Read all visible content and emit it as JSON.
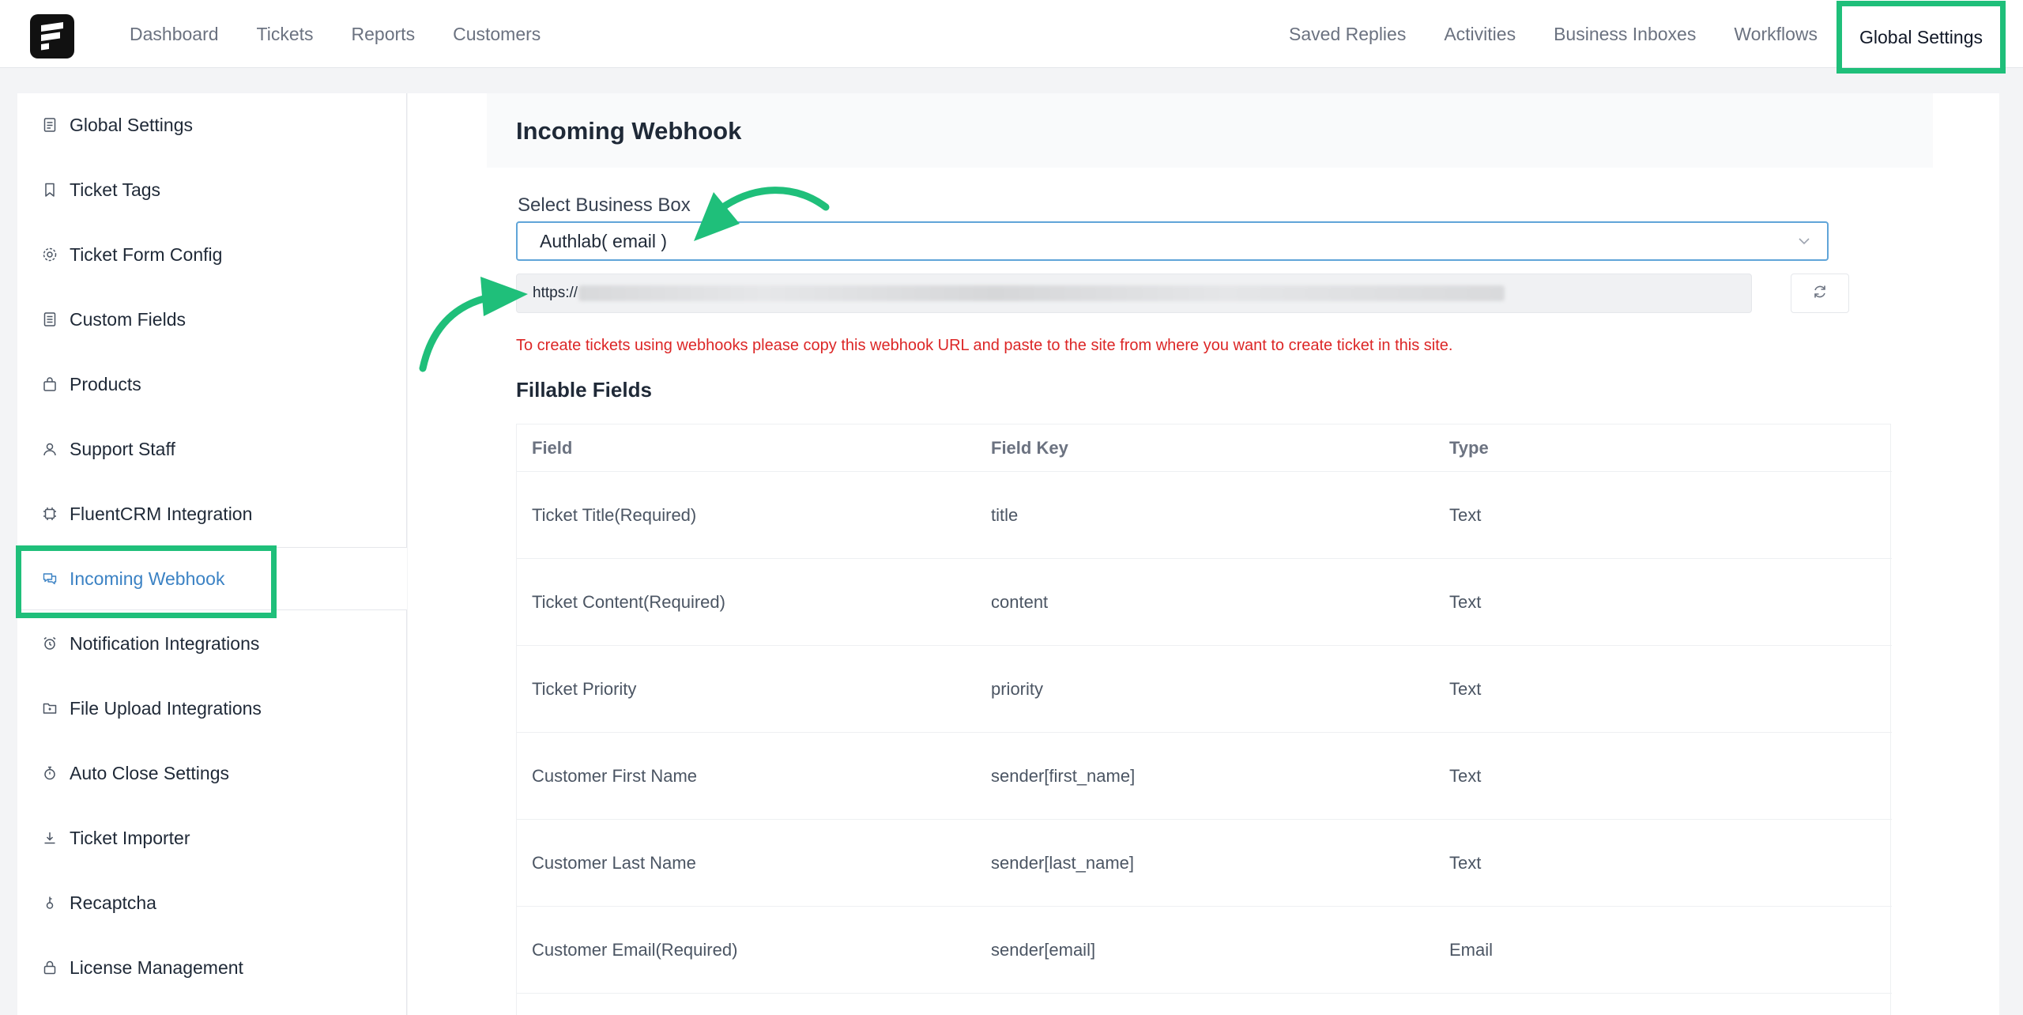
{
  "topnav": {
    "left": [
      "Dashboard",
      "Tickets",
      "Reports",
      "Customers"
    ],
    "right": [
      "Saved Replies",
      "Activities",
      "Business Inboxes",
      "Workflows"
    ],
    "active": "Global Settings"
  },
  "sidebar": {
    "items": [
      {
        "label": "Global Settings",
        "icon": "document-icon"
      },
      {
        "label": "Ticket Tags",
        "icon": "bookmark-icon"
      },
      {
        "label": "Ticket Form Config",
        "icon": "gear-icon"
      },
      {
        "label": "Custom Fields",
        "icon": "list-icon"
      },
      {
        "label": "Products",
        "icon": "bag-icon"
      },
      {
        "label": "Support Staff",
        "icon": "user-icon"
      },
      {
        "label": "FluentCRM Integration",
        "icon": "chip-icon"
      },
      {
        "label": "Incoming Webhook",
        "icon": "chat-icon"
      },
      {
        "label": "Notification Integrations",
        "icon": "alarm-icon"
      },
      {
        "label": "File Upload Integrations",
        "icon": "folder-icon"
      },
      {
        "label": "Auto Close Settings",
        "icon": "timer-icon"
      },
      {
        "label": "Ticket Importer",
        "icon": "download-icon"
      },
      {
        "label": "Recaptcha",
        "icon": "key-icon"
      },
      {
        "label": "License Management",
        "icon": "lock-icon"
      }
    ],
    "active_index": 7
  },
  "main": {
    "title": "Incoming Webhook",
    "select_label": "Select Business Box",
    "select_value": "Authlab( email )",
    "url_value": "https://",
    "notice": "To create tickets using webhooks please copy this webhook URL and paste to the site from where you want to create ticket in this site.",
    "fields_title": "Fillable Fields",
    "table": {
      "headers": [
        "Field",
        "Field Key",
        "Type"
      ],
      "rows": [
        [
          "Ticket Title(Required)",
          "title",
          "Text"
        ],
        [
          "Ticket Content(Required)",
          "content",
          "Text"
        ],
        [
          "Ticket Priority",
          "priority",
          "Text"
        ],
        [
          "Customer First Name",
          "sender[first_name]",
          "Text"
        ],
        [
          "Customer Last Name",
          "sender[last_name]",
          "Text"
        ],
        [
          "Customer Email(Required)",
          "sender[email]",
          "Email"
        ]
      ]
    }
  },
  "colors": {
    "highlight": "#1fbf7a",
    "active_link": "#3b82c4",
    "notice": "#dc2626",
    "select_border": "#60a5d8"
  }
}
